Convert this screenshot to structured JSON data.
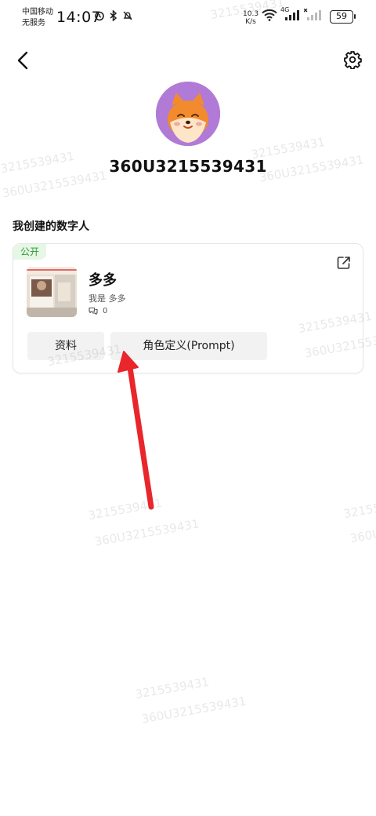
{
  "status_bar": {
    "carrier_line1": "中国移动",
    "carrier_line2": "无服务",
    "time": "14:07",
    "net_speed_value": "10.3",
    "net_speed_unit": "K/s",
    "network_type": "4G",
    "battery": "59",
    "icons_left": [
      "alarm-icon",
      "bluetooth-icon",
      "mute-icon"
    ],
    "icons_right": [
      "wifi-icon",
      "signal-icon",
      "signal-no-service-icon"
    ]
  },
  "header": {
    "back_icon": "chevron-left-icon",
    "settings_icon": "gear-icon"
  },
  "profile": {
    "username": "360U3215539431",
    "avatar_icon": "fox-avatar"
  },
  "section": {
    "title": "我创建的数字人"
  },
  "bot_card": {
    "badge": "公开",
    "name": "多多",
    "intro": "我是 多多",
    "chat_count": "0",
    "share_icon": "external-link-icon",
    "tabs": [
      "资料",
      "角色定义(Prompt)"
    ]
  },
  "watermark": {
    "text_short": "3215539431",
    "text_long": "360U3215539431"
  },
  "colors": {
    "avatar_bg": "#b07ad6",
    "badge_text": "#2f9a3a",
    "badge_bg": "#e7f7e6",
    "annotation_arrow": "#e8262b"
  }
}
